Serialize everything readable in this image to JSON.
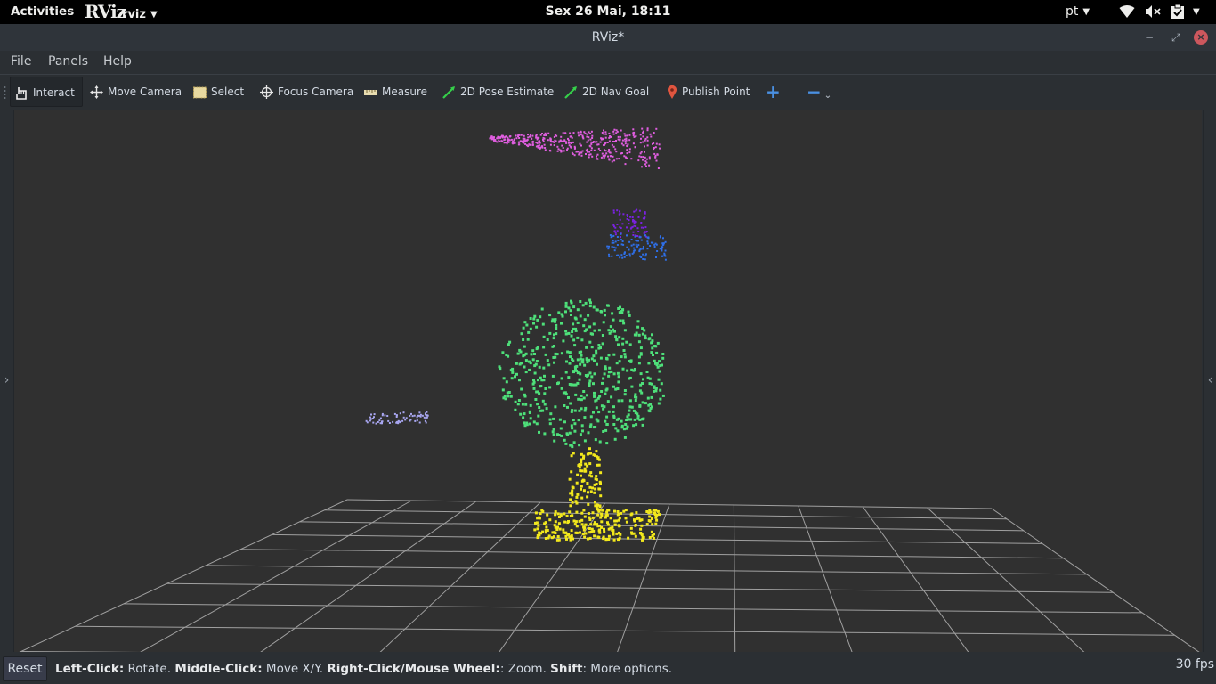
{
  "topbar": {
    "activities": "Activities",
    "app_logo": "RViz",
    "app_name": "rviz",
    "clock": "Sex 26 Mai, 18:11",
    "language": "pt",
    "tray_icons": [
      "wifi-icon",
      "volume-muted-icon",
      "clipboard-check-icon",
      "power-menu-caret"
    ]
  },
  "window": {
    "title": "RViz*",
    "controls": [
      "minimize-icon",
      "maximize-icon",
      "close-icon"
    ]
  },
  "menubar": {
    "items": [
      {
        "label": "File",
        "mnemonic": "F"
      },
      {
        "label": "Panels",
        "mnemonic": "P"
      },
      {
        "label": "Help",
        "mnemonic": "H"
      }
    ]
  },
  "toolbar": {
    "tools": [
      {
        "label": "Interact",
        "icon": "hand-pointer-icon",
        "active": true
      },
      {
        "label": "Move Camera",
        "icon": "move-arrows-icon"
      },
      {
        "label": "Select",
        "icon": "select-rectangle-icon"
      },
      {
        "label": "Focus Camera",
        "icon": "crosshair-icon"
      },
      {
        "label": "Measure",
        "icon": "ruler-icon"
      },
      {
        "label": "2D Pose Estimate",
        "icon": "green-arrow-icon"
      },
      {
        "label": "2D Nav Goal",
        "icon": "green-arrow-icon"
      },
      {
        "label": "Publish Point",
        "icon": "map-pin-icon"
      }
    ],
    "add_tool": "+",
    "remove_tool": "−"
  },
  "viewport": {
    "background": "#303030",
    "grid_color": "#a0a0a0",
    "point_clouds": [
      {
        "name": "pink-cloud",
        "color": "#e05ee0"
      },
      {
        "name": "purple-cloud",
        "color": "#7a22e0"
      },
      {
        "name": "blue-cloud",
        "color": "#2f6fe8"
      },
      {
        "name": "green-cloud",
        "color": "#4ee07a"
      },
      {
        "name": "lavender-cloud",
        "color": "#a8a6f0"
      },
      {
        "name": "yellow-cloud",
        "color": "#f2e81c"
      }
    ]
  },
  "statusbar": {
    "reset": "Reset",
    "hint": [
      {
        "bold": "Left-Click:",
        "text": " Rotate. "
      },
      {
        "bold": "Middle-Click:",
        "text": " Move X/Y. "
      },
      {
        "bold": "Right-Click/Mouse Wheel:",
        "text": ": Zoom. "
      },
      {
        "bold": "Shift",
        "text": ": More options."
      }
    ],
    "fps": "30 fps"
  }
}
